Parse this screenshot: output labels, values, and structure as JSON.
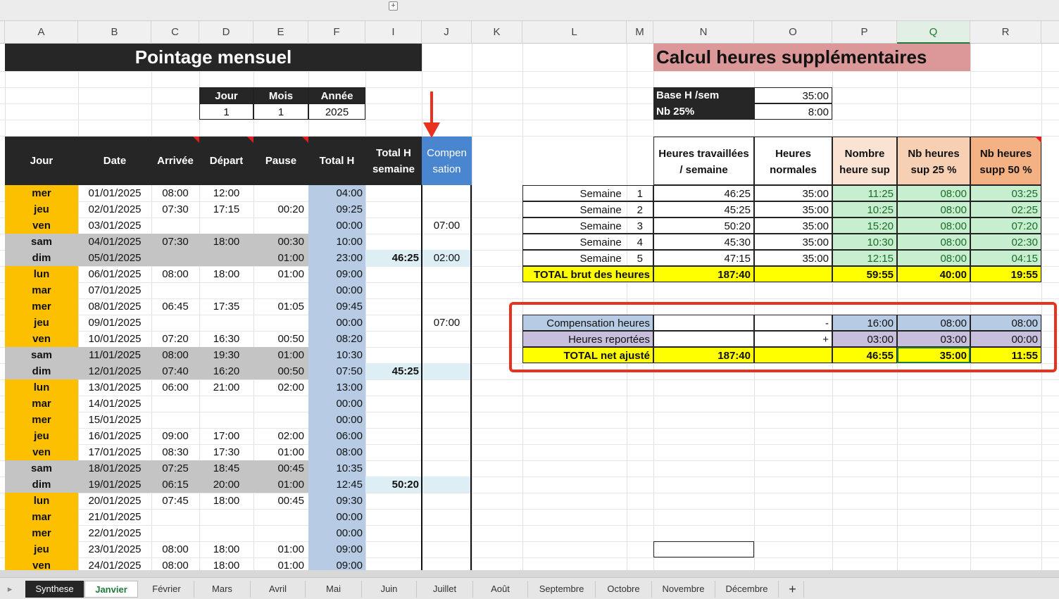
{
  "columns": [
    "A",
    "B",
    "C",
    "D",
    "E",
    "F",
    "I",
    "J",
    "K",
    "L",
    "M",
    "N",
    "O",
    "P",
    "Q",
    "R"
  ],
  "selected_column": "Q",
  "expand_icon": "plus-square-icon",
  "left": {
    "title": "Pointage mensuel",
    "date_headers": [
      "Jour",
      "Mois",
      "Année"
    ],
    "date_values": [
      "1",
      "1",
      "2025"
    ],
    "table_headers": {
      "jour": "Jour",
      "date": "Date",
      "arrivee": "Arrivée",
      "depart": "Départ",
      "pause": "Pause",
      "total": "Total H",
      "semaine_l1": "Total H",
      "semaine_l2": "semaine",
      "comp_l1": "Compen",
      "comp_l2": "sation"
    },
    "rows": [
      {
        "jour": "mer",
        "date": "01/01/2025",
        "arr": "08:00",
        "dep": "12:00",
        "pause": "",
        "total": "04:00",
        "sem": "",
        "comp": "",
        "kind": "week"
      },
      {
        "jour": "jeu",
        "date": "02/01/2025",
        "arr": "07:30",
        "dep": "17:15",
        "pause": "00:20",
        "total": "09:25",
        "sem": "",
        "comp": "",
        "kind": "week"
      },
      {
        "jour": "ven",
        "date": "03/01/2025",
        "arr": "",
        "dep": "",
        "pause": "",
        "total": "00:00",
        "sem": "",
        "comp": "07:00",
        "kind": "week"
      },
      {
        "jour": "sam",
        "date": "04/01/2025",
        "arr": "07:30",
        "dep": "18:00",
        "pause": "00:30",
        "total": "10:00",
        "sem": "",
        "comp": "",
        "kind": "weekend"
      },
      {
        "jour": "dim",
        "date": "05/01/2025",
        "arr": "",
        "dep": "",
        "pause": "01:00",
        "total": "23:00",
        "sem": "46:25",
        "comp": "02:00",
        "kind": "weekend"
      },
      {
        "jour": "lun",
        "date": "06/01/2025",
        "arr": "08:00",
        "dep": "18:00",
        "pause": "01:00",
        "total": "09:00",
        "sem": "",
        "comp": "",
        "kind": "week"
      },
      {
        "jour": "mar",
        "date": "07/01/2025",
        "arr": "",
        "dep": "",
        "pause": "",
        "total": "00:00",
        "sem": "",
        "comp": "",
        "kind": "week"
      },
      {
        "jour": "mer",
        "date": "08/01/2025",
        "arr": "06:45",
        "dep": "17:35",
        "pause": "01:05",
        "total": "09:45",
        "sem": "",
        "comp": "",
        "kind": "week"
      },
      {
        "jour": "jeu",
        "date": "09/01/2025",
        "arr": "",
        "dep": "",
        "pause": "",
        "total": "00:00",
        "sem": "",
        "comp": "07:00",
        "kind": "week"
      },
      {
        "jour": "ven",
        "date": "10/01/2025",
        "arr": "07:20",
        "dep": "16:30",
        "pause": "00:50",
        "total": "08:20",
        "sem": "",
        "comp": "",
        "kind": "week"
      },
      {
        "jour": "sam",
        "date": "11/01/2025",
        "arr": "08:00",
        "dep": "19:30",
        "pause": "01:00",
        "total": "10:30",
        "sem": "",
        "comp": "",
        "kind": "weekend"
      },
      {
        "jour": "dim",
        "date": "12/01/2025",
        "arr": "07:40",
        "dep": "16:20",
        "pause": "00:50",
        "total": "07:50",
        "sem": "45:25",
        "comp": "",
        "kind": "weekend"
      },
      {
        "jour": "lun",
        "date": "13/01/2025",
        "arr": "06:00",
        "dep": "21:00",
        "pause": "02:00",
        "total": "13:00",
        "sem": "",
        "comp": "",
        "kind": "week"
      },
      {
        "jour": "mar",
        "date": "14/01/2025",
        "arr": "",
        "dep": "",
        "pause": "",
        "total": "00:00",
        "sem": "",
        "comp": "",
        "kind": "week"
      },
      {
        "jour": "mer",
        "date": "15/01/2025",
        "arr": "",
        "dep": "",
        "pause": "",
        "total": "00:00",
        "sem": "",
        "comp": "",
        "kind": "week"
      },
      {
        "jour": "jeu",
        "date": "16/01/2025",
        "arr": "09:00",
        "dep": "17:00",
        "pause": "02:00",
        "total": "06:00",
        "sem": "",
        "comp": "",
        "kind": "week"
      },
      {
        "jour": "ven",
        "date": "17/01/2025",
        "arr": "08:30",
        "dep": "17:30",
        "pause": "01:00",
        "total": "08:00",
        "sem": "",
        "comp": "",
        "kind": "week"
      },
      {
        "jour": "sam",
        "date": "18/01/2025",
        "arr": "07:25",
        "dep": "18:45",
        "pause": "00:45",
        "total": "10:35",
        "sem": "",
        "comp": "",
        "kind": "weekend"
      },
      {
        "jour": "dim",
        "date": "19/01/2025",
        "arr": "06:15",
        "dep": "20:00",
        "pause": "01:00",
        "total": "12:45",
        "sem": "50:20",
        "comp": "",
        "kind": "weekend"
      },
      {
        "jour": "lun",
        "date": "20/01/2025",
        "arr": "07:45",
        "dep": "18:00",
        "pause": "00:45",
        "total": "09:30",
        "sem": "",
        "comp": "",
        "kind": "week"
      },
      {
        "jour": "mar",
        "date": "21/01/2025",
        "arr": "",
        "dep": "",
        "pause": "",
        "total": "00:00",
        "sem": "",
        "comp": "",
        "kind": "week"
      },
      {
        "jour": "mer",
        "date": "22/01/2025",
        "arr": "",
        "dep": "",
        "pause": "",
        "total": "00:00",
        "sem": "",
        "comp": "",
        "kind": "week"
      },
      {
        "jour": "jeu",
        "date": "23/01/2025",
        "arr": "08:00",
        "dep": "18:00",
        "pause": "01:00",
        "total": "09:00",
        "sem": "",
        "comp": "",
        "kind": "week"
      },
      {
        "jour": "ven",
        "date": "24/01/2025",
        "arr": "08:00",
        "dep": "18:00",
        "pause": "01:00",
        "total": "09:00",
        "sem": "",
        "comp": "",
        "kind": "week"
      }
    ]
  },
  "right": {
    "title": "Calcul heures supplémentaires",
    "base_label": "Base H /sem",
    "base_value": "35:00",
    "nb25_label": "Nb 25%",
    "nb25_value": "8:00",
    "headers": {
      "n_l1": "Heures travaillées",
      "n_l2": "/ semaine",
      "o_l1": "Heures",
      "o_l2": "normales",
      "p_l1": "Nombre",
      "p_l2": "heure sup",
      "q_l1": "Nb heures",
      "q_l2": "sup 25 %",
      "r_l1": "Nb heures",
      "r_l2": "supp 50 %"
    },
    "weeks": [
      {
        "label": "Semaine",
        "num": "1",
        "worked": "46:25",
        "normal": "35:00",
        "sup": "11:25",
        "s25": "08:00",
        "s50": "03:25"
      },
      {
        "label": "Semaine",
        "num": "2",
        "worked": "45:25",
        "normal": "35:00",
        "sup": "10:25",
        "s25": "08:00",
        "s50": "02:25"
      },
      {
        "label": "Semaine",
        "num": "3",
        "worked": "50:20",
        "normal": "35:00",
        "sup": "15:20",
        "s25": "08:00",
        "s50": "07:20"
      },
      {
        "label": "Semaine",
        "num": "4",
        "worked": "45:30",
        "normal": "35:00",
        "sup": "10:30",
        "s25": "08:00",
        "s50": "02:30"
      },
      {
        "label": "Semaine",
        "num": "5",
        "worked": "47:15",
        "normal": "35:00",
        "sup": "12:15",
        "s25": "08:00",
        "s50": "04:15"
      }
    ],
    "total_brut": {
      "label": "TOTAL brut des heures",
      "worked": "187:40",
      "sup": "59:55",
      "s25": "40:00",
      "s50": "19:55"
    },
    "compensation": {
      "label": "Compensation heures",
      "sign": "-",
      "sup": "16:00",
      "s25": "08:00",
      "s50": "08:00"
    },
    "reportees": {
      "label": "Heures reportées",
      "sign": "+",
      "sup": "03:00",
      "s25": "03:00",
      "s50": "00:00"
    },
    "total_net": {
      "label": "TOTAL net ajusté",
      "worked": "187:40",
      "sup": "46:55",
      "s25": "35:00",
      "s50": "11:55"
    }
  },
  "tabs": [
    "Synthese",
    "Janvier",
    "Février",
    "Mars",
    "Avril",
    "Mai",
    "Juin",
    "Juillet",
    "Août",
    "Septembre",
    "Octobre",
    "Novembre",
    "Décembre"
  ],
  "active_tab": "Janvier",
  "add_sheet_label": "+",
  "colors": {
    "accent_red": "#e8321e",
    "orange": "#fdc000",
    "dark": "#262626",
    "yellow": "#ffff00"
  }
}
